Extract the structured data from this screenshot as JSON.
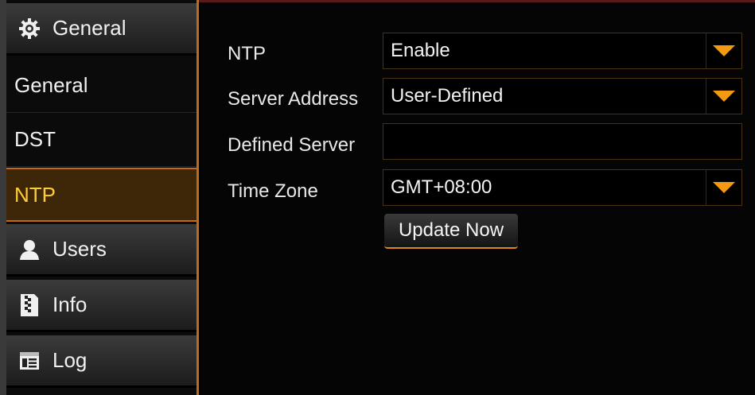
{
  "sidebar": {
    "header": {
      "label": "General",
      "icon": "gear-icon"
    },
    "items": [
      {
        "label": "General"
      },
      {
        "label": "DST"
      },
      {
        "label": "NTP",
        "active": true
      }
    ],
    "categories": [
      {
        "label": "Users",
        "icon": "user-icon"
      },
      {
        "label": "Info",
        "icon": "info-icon"
      },
      {
        "label": "Log",
        "icon": "log-icon"
      }
    ]
  },
  "form": {
    "ntp": {
      "label": "NTP",
      "value": "Enable"
    },
    "server_address": {
      "label": "Server Address",
      "value": "User-Defined"
    },
    "defined_server": {
      "label": "Defined Server",
      "value": ""
    },
    "time_zone": {
      "label": "Time Zone",
      "value": "GMT+08:00"
    },
    "update_button": "Update Now"
  },
  "colors": {
    "accent": "#f39a12",
    "active_text": "#ffcc33",
    "active_bg": "#3e2608"
  }
}
